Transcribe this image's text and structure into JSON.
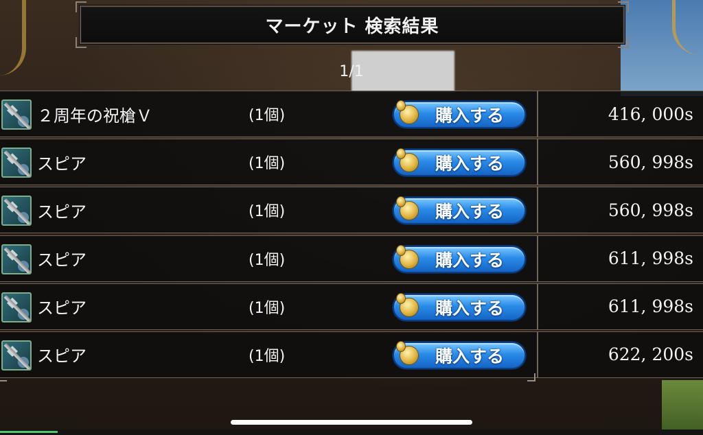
{
  "header": {
    "title": "マーケット 検索結果"
  },
  "pager": {
    "text": "1/1"
  },
  "rows": [
    {
      "name": "２周年の祝槍Ｖ",
      "qty": "(1個)",
      "buy_label": "購入する",
      "price": "416, 000s",
      "icon": "spear-icon"
    },
    {
      "name": "スピア",
      "qty": "(1個)",
      "buy_label": "購入する",
      "price": "560, 998s",
      "icon": "spear-icon"
    },
    {
      "name": "スピア",
      "qty": "(1個)",
      "buy_label": "購入する",
      "price": "560, 998s",
      "icon": "spear-icon"
    },
    {
      "name": "スピア",
      "qty": "(1個)",
      "buy_label": "購入する",
      "price": "611, 998s",
      "icon": "spear-icon"
    },
    {
      "name": "スピア",
      "qty": "(1個)",
      "buy_label": "購入する",
      "price": "611, 998s",
      "icon": "spear-icon"
    },
    {
      "name": "スピア",
      "qty": "(1個)",
      "buy_label": "購入する",
      "price": "622, 200s",
      "icon": "spear-icon"
    }
  ],
  "colors": {
    "button_blue": "#2a8be8",
    "panel_dark": "#0e0e0e",
    "border_gray": "#6e665d"
  }
}
